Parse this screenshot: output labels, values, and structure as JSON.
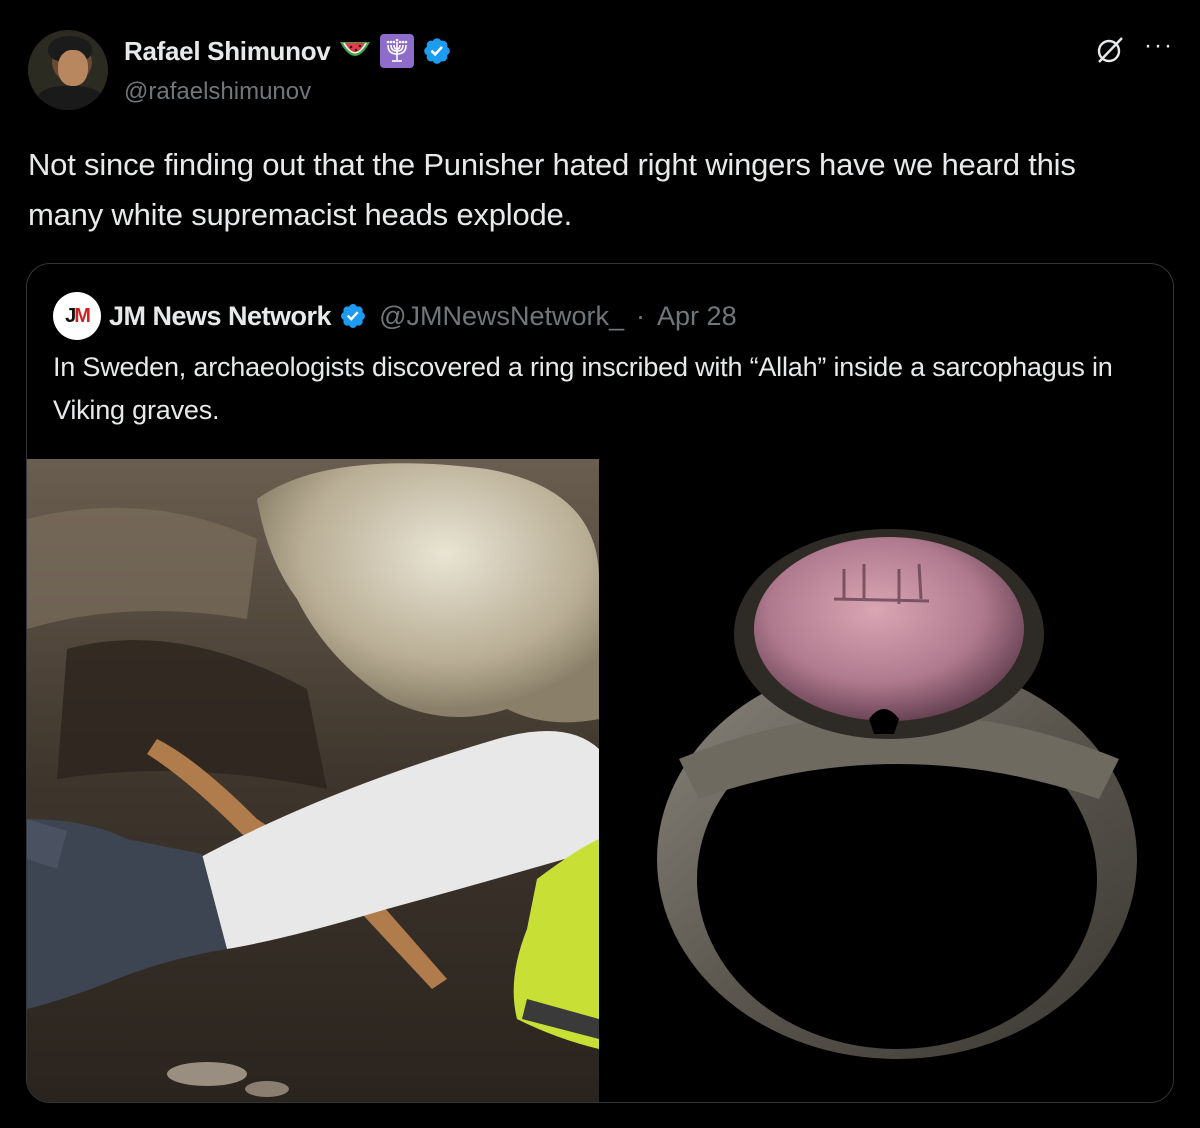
{
  "post": {
    "author_name": "Rafael Shimunov",
    "author_handle": "@rafaelshimunov",
    "badges": [
      "watermelon-emoji",
      "menorah-emoji",
      "verified-badge"
    ],
    "text": "Not since finding out that the Punisher hated right wingers have we heard this many white supremacist heads explode."
  },
  "quoted": {
    "author_name": "JM News Network",
    "author_handle": "@JMNewsNetwork_",
    "separator": "·",
    "date": "Apr 28",
    "logo_text": "JM",
    "text": "In Sweden, archaeologists discovered a ring inscribed with “Allah” inside a sarcophagus in Viking graves.",
    "images": [
      "excavation-photo",
      "ring-photo"
    ]
  },
  "icons": [
    "grok-icon",
    "more-options-icon"
  ],
  "colors": {
    "background": "#000000",
    "text": "#e7e9ea",
    "secondary_text": "#71767b",
    "verified": "#1d9bf0",
    "border": "#333639"
  }
}
